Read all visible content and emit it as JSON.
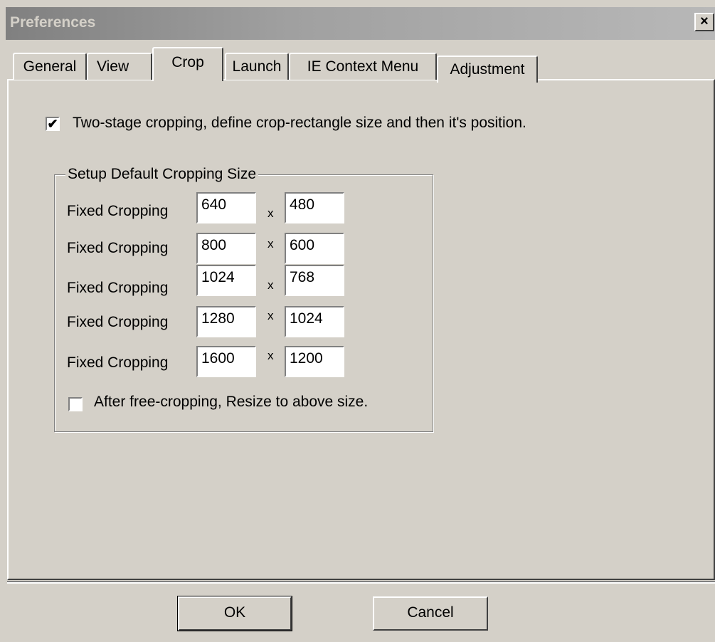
{
  "window": {
    "title": "Preferences",
    "close_label": "×"
  },
  "tabs": [
    {
      "label": "General"
    },
    {
      "label": "View"
    },
    {
      "label": "Crop"
    },
    {
      "label": "Launch"
    },
    {
      "label": "IE Context Menu"
    },
    {
      "label": "Adjustment"
    }
  ],
  "active_tab": "Crop",
  "crop": {
    "two_stage": {
      "checked": true,
      "mark": "✔",
      "label": "Two-stage cropping, define crop-rectangle size and then it's position."
    },
    "group_title": "Setup Default Cropping Size",
    "rows": [
      {
        "label": "Fixed Cropping",
        "width": "640",
        "height": "480",
        "sep": "x"
      },
      {
        "label": "Fixed Cropping",
        "width": "800",
        "height": "600",
        "sep": "x"
      },
      {
        "label": "Fixed Cropping",
        "width": "1024",
        "height": "768",
        "sep": "x"
      },
      {
        "label": "Fixed Cropping",
        "width": "1280",
        "height": "1024",
        "sep": "x"
      },
      {
        "label": "Fixed Cropping",
        "width": "1600",
        "height": "1200",
        "sep": "x"
      }
    ],
    "resize_after": {
      "checked": false,
      "label": "After free-cropping, Resize to above size."
    }
  },
  "buttons": {
    "ok": "OK",
    "cancel": "Cancel"
  },
  "colors": {
    "face": "#d4d0c8",
    "title_gradient_start": "#808080"
  }
}
